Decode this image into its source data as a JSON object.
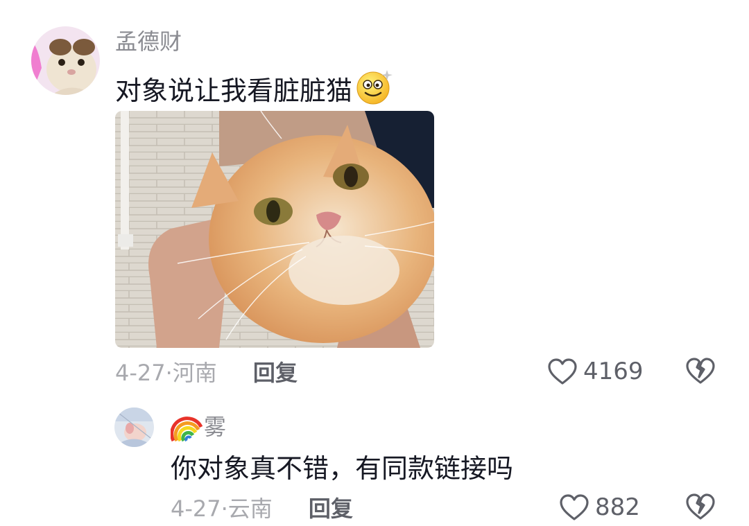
{
  "comments": [
    {
      "author": "孟德财",
      "text": "对象说让我看脏脏猫",
      "emoji": "dizzy-smile-emoji",
      "has_image": true,
      "date": "4-27",
      "location_sep": "· ",
      "location": "河南",
      "reply_label": "回复",
      "likes": "4169"
    },
    {
      "author_badge": "rainbow-emoji",
      "author": "雾",
      "text": "你对象真不错，有同款链接吗",
      "date": "4-27",
      "location_sep": "· ",
      "location": "云南",
      "reply_label": "回复",
      "likes": "882"
    }
  ],
  "colors": {
    "text_primary": "#161823",
    "text_secondary": "#8a8b91",
    "meta": "#a8a9ae",
    "action": "#5e6068"
  }
}
